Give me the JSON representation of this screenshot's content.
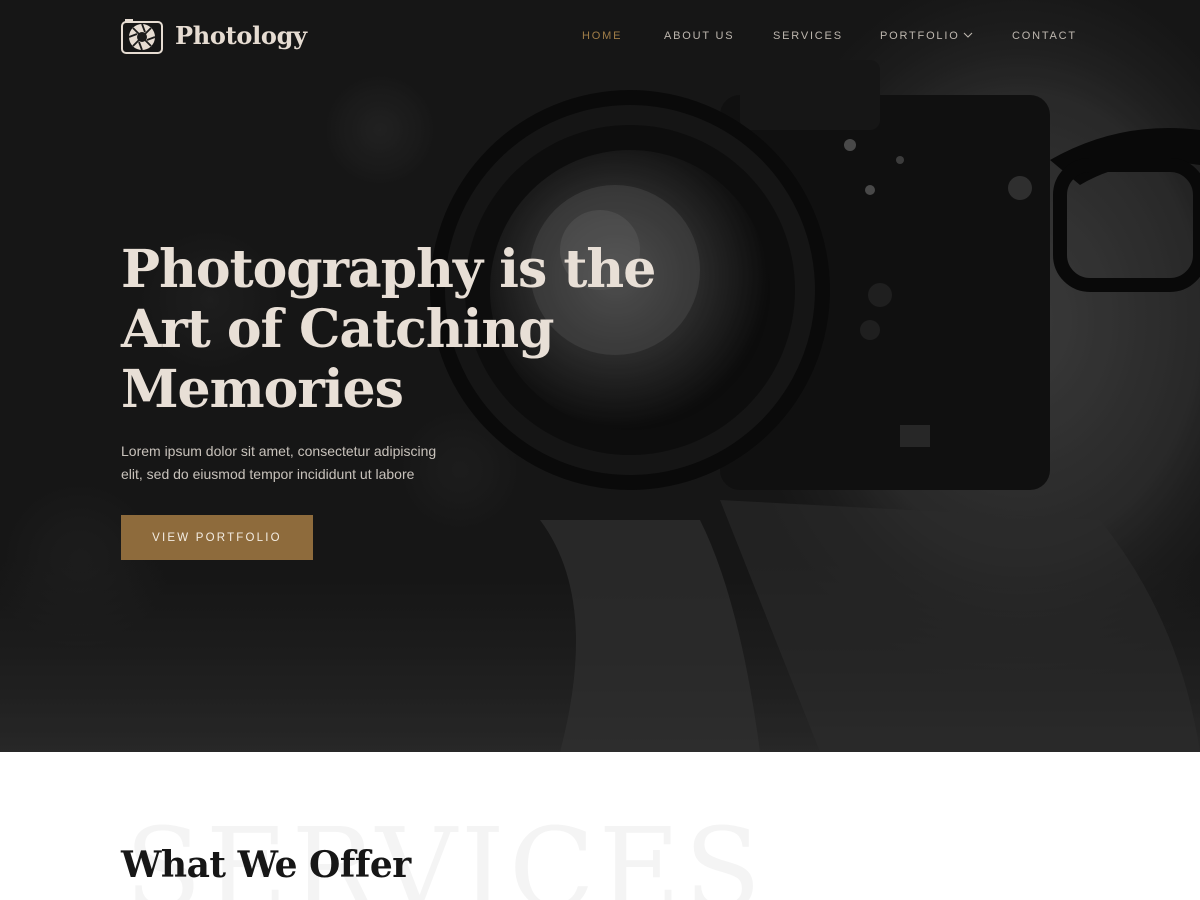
{
  "brand": {
    "name": "Photology",
    "accent_color": "#8e6b3c",
    "icon": "camera-aperture-icon"
  },
  "nav": {
    "items": [
      {
        "label": "HOME",
        "active": true
      },
      {
        "label": "ABOUT US",
        "active": false
      },
      {
        "label": "SERVICES",
        "active": false
      },
      {
        "label": "PORTFOLIO",
        "active": false,
        "has_dropdown": true,
        "dropdown_icon": "chevron-down-icon"
      },
      {
        "label": "CONTACT",
        "active": false
      }
    ]
  },
  "hero": {
    "title_lines": [
      "Photography is the",
      "Art of Catching",
      "Memories"
    ],
    "description": "Lorem ipsum dolor sit amet, consectetur adipiscing elit, sed do eiusmod tempor incididunt ut labore",
    "button_label": "VIEW PORTFOLIO",
    "background": "dark monochrome photo of person holding camera"
  },
  "services": {
    "background_word": "SERVICES",
    "title": "What We Offer"
  }
}
